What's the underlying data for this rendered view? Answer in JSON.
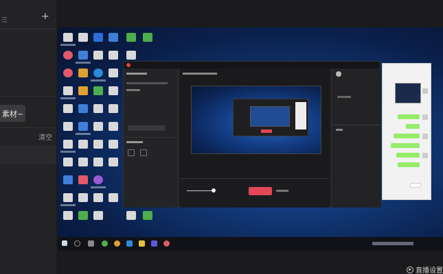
{
  "sidebar": {
    "top_text": "三",
    "add_label": "+",
    "material_button": "素材~",
    "clear_label": "清空"
  },
  "watermark": {
    "text": "直播设置"
  },
  "colors": {
    "accent_live": "#e24757",
    "desktop_blue": "#123a7a",
    "panel_dark": "#1f1f22"
  },
  "icons": {
    "add": "plus-icon",
    "watermark": "record-icon"
  }
}
